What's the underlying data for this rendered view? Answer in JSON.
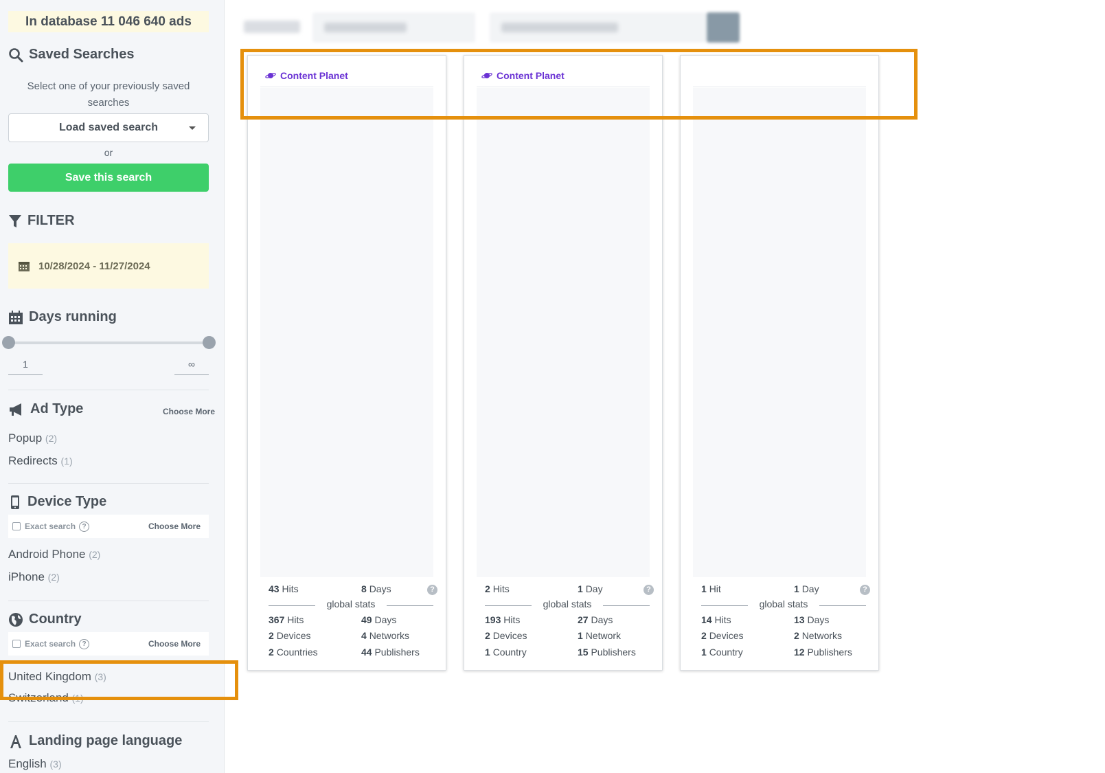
{
  "sidebar": {
    "db_banner": "In database 11 046 640 ads",
    "saved_searches": {
      "title": "Saved Searches",
      "hint": "Select one of your previously saved searches",
      "load_label": "Load saved search",
      "or": "or",
      "save_label": "Save this search"
    },
    "filter": {
      "title": "FILTER",
      "date_range": "10/28/2024 - 11/27/2024"
    },
    "days_running": {
      "title": "Days running",
      "min": "1",
      "max": "∞"
    },
    "ad_type": {
      "title": "Ad Type",
      "choose_more": "Choose More",
      "items": [
        {
          "label": "Popup",
          "count": "(2)"
        },
        {
          "label": "Redirects",
          "count": "(1)"
        }
      ]
    },
    "device_type": {
      "title": "Device Type",
      "exact_search": "Exact search",
      "choose_more": "Choose More",
      "items": [
        {
          "label": "Android Phone",
          "count": "(2)"
        },
        {
          "label": "iPhone",
          "count": "(2)"
        }
      ]
    },
    "country": {
      "title": "Country",
      "exact_search": "Exact search",
      "choose_more": "Choose More",
      "items": [
        {
          "label": "United Kingdom",
          "count": "(3)"
        },
        {
          "label": "Switzerland",
          "count": "(1)"
        }
      ]
    },
    "landing_language": {
      "title": "Landing page language",
      "items": [
        {
          "label": "English",
          "count": "(3)"
        }
      ]
    }
  },
  "cards": [
    {
      "brand": "Content Planet",
      "hits": "43",
      "hits_unit": "Hits",
      "days": "8",
      "days_unit": "Days",
      "global_stats": "global stats",
      "g_hits": "367",
      "g_hits_unit": "Hits",
      "g_days": "49",
      "g_days_unit": "Days",
      "devices": "2",
      "devices_unit": "Devices",
      "networks": "4",
      "networks_unit": "Networks",
      "countries": "2",
      "countries_unit": "Countries",
      "publishers": "44",
      "publishers_unit": "Publishers"
    },
    {
      "brand": "Content Planet",
      "hits": "2",
      "hits_unit": "Hits",
      "days": "1",
      "days_unit": "Day",
      "global_stats": "global stats",
      "g_hits": "193",
      "g_hits_unit": "Hits",
      "g_days": "27",
      "g_days_unit": "Days",
      "devices": "2",
      "devices_unit": "Devices",
      "networks": "1",
      "networks_unit": "Network",
      "countries": "1",
      "countries_unit": "Country",
      "publishers": "15",
      "publishers_unit": "Publishers"
    },
    {
      "brand": "",
      "hits": "1",
      "hits_unit": "Hit",
      "days": "1",
      "days_unit": "Day",
      "global_stats": "global stats",
      "g_hits": "14",
      "g_hits_unit": "Hits",
      "g_days": "13",
      "g_days_unit": "Days",
      "devices": "2",
      "devices_unit": "Devices",
      "networks": "2",
      "networks_unit": "Networks",
      "countries": "1",
      "countries_unit": "Country",
      "publishers": "12",
      "publishers_unit": "Publishers"
    }
  ],
  "colors": {
    "accent_green": "#3ecf6a",
    "highlight_orange": "#e5900d",
    "brand_purple": "#6a32d4"
  }
}
